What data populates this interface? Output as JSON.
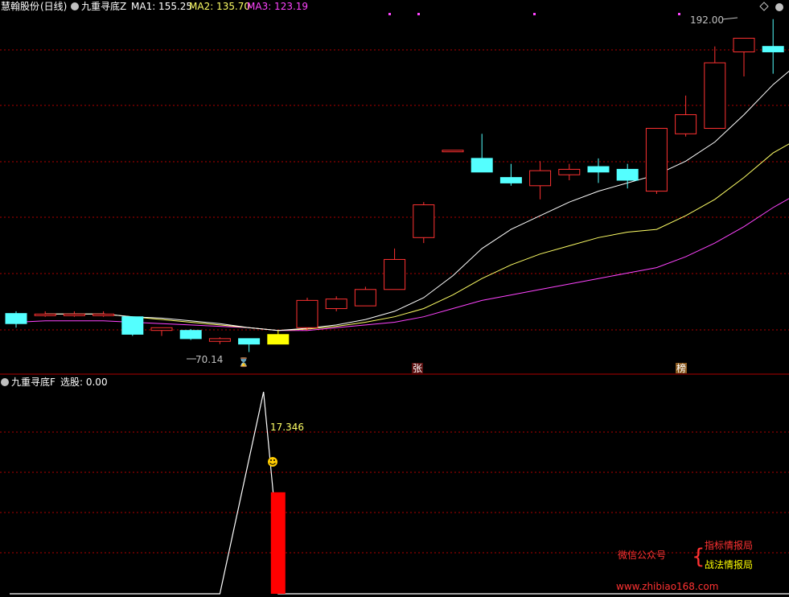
{
  "upper_panel": {
    "stock_name": "慧翰股份",
    "period": "(日线)",
    "indicator_name": "九重寻底Z",
    "ma1_label": "MA1: 155.25",
    "ma2_label": "MA2: 135.70",
    "ma3_label": "MA3: 123.19",
    "high_marker": "192.00",
    "low_marker": "70.14",
    "badge_zhang": "张",
    "badge_bang": "榜"
  },
  "lower_panel": {
    "indicator_name": "九重寻底F",
    "select_label": "选股: 0.00",
    "value_label": "17.346"
  },
  "watermark": {
    "wechat": "微信公众号",
    "line1": "指标情报局",
    "line2": "战法情报局",
    "url": "www.zhibiao168.com"
  },
  "colors": {
    "up": "#ff3232",
    "down": "#54ffff",
    "ma1": "#ffffff",
    "ma2": "#ffff66",
    "ma3": "#ff44ff",
    "grid": "#b00000",
    "signal_bar": "#ff0000",
    "highlight_candle": "#ffff00"
  },
  "chart_data": [
    {
      "type": "candlestick",
      "title": "九重寻底Z",
      "ylim": [
        62,
        199
      ],
      "candles": [
        {
          "o": 84.2,
          "h": 85.0,
          "l": 79.0,
          "c": 80.5
        },
        {
          "o": 84.0,
          "h": 85.0,
          "l": 83.0,
          "c": 84.0
        },
        {
          "o": 84.0,
          "h": 85.0,
          "l": 83.0,
          "c": 84.0
        },
        {
          "o": 84.0,
          "h": 85.0,
          "l": 83.0,
          "c": 84.0
        },
        {
          "o": 83.0,
          "h": 83.0,
          "l": 76.0,
          "c": 76.6
        },
        {
          "o": 78.0,
          "h": 79.0,
          "l": 76.0,
          "c": 79.0
        },
        {
          "o": 78.0,
          "h": 78.5,
          "l": 74.5,
          "c": 75.0
        },
        {
          "o": 74.0,
          "h": 75.5,
          "l": 73.0,
          "c": 75.0
        },
        {
          "o": 75.0,
          "h": 75.0,
          "l": 70.1,
          "c": 73.0
        },
        {
          "o": 73.0,
          "h": 78.0,
          "l": 73.0,
          "c": 76.5
        },
        {
          "o": 79.0,
          "h": 90.0,
          "l": 78.0,
          "c": 89.0
        },
        {
          "o": 86.0,
          "h": 90.5,
          "l": 85.0,
          "c": 89.5
        },
        {
          "o": 87.0,
          "h": 94.0,
          "l": 87.0,
          "c": 93.0
        },
        {
          "o": 93.0,
          "h": 108.0,
          "l": 93.0,
          "c": 104.0
        },
        {
          "o": 112.0,
          "h": 125.0,
          "l": 110.0,
          "c": 124.0
        },
        {
          "o": 144.0,
          "h": 144.0,
          "l": 144.0,
          "c": 144.0
        },
        {
          "o": 141.0,
          "h": 150.0,
          "l": 136.0,
          "c": 136.0
        },
        {
          "o": 134.0,
          "h": 139.0,
          "l": 131.0,
          "c": 132.0
        },
        {
          "o": 131.0,
          "h": 140.0,
          "l": 126.0,
          "c": 136.5
        },
        {
          "o": 135.0,
          "h": 139.0,
          "l": 133.0,
          "c": 137.0
        },
        {
          "o": 138.0,
          "h": 141.0,
          "l": 132.0,
          "c": 136.0
        },
        {
          "o": 137.0,
          "h": 139.0,
          "l": 130.0,
          "c": 133.0
        },
        {
          "o": 129.0,
          "h": 152.0,
          "l": 128.0,
          "c": 152.0
        },
        {
          "o": 150.0,
          "h": 164.0,
          "l": 149.0,
          "c": 157.0
        },
        {
          "o": 152.0,
          "h": 182.0,
          "l": 152.0,
          "c": 176.0
        },
        {
          "o": 180.0,
          "h": 183.0,
          "l": 171.0,
          "c": 185.0
        },
        {
          "o": 182.0,
          "h": 192.0,
          "l": 172.0,
          "c": 180.0
        },
        {
          "o": 172.0,
          "h": 188.0,
          "l": 171.0,
          "c": 188.0
        }
      ],
      "ma1": [
        null,
        84,
        84,
        84,
        83,
        82.5,
        81.5,
        80.5,
        79,
        78,
        78.8,
        80,
        82,
        85,
        90,
        98,
        108,
        115,
        120,
        125,
        129,
        132,
        135,
        140,
        147,
        157,
        168,
        177
      ],
      "ma2": [
        null,
        84,
        84,
        84,
        83,
        82,
        81,
        80,
        79,
        78,
        78.5,
        79.5,
        81,
        83,
        86,
        91,
        97,
        102,
        106,
        109,
        112,
        114,
        115,
        120,
        126,
        134,
        143,
        149
      ],
      "ma3": [
        81,
        81.5,
        81.5,
        81.5,
        81,
        80.5,
        80,
        79.5,
        79,
        78,
        78,
        79,
        80,
        81,
        83,
        86,
        89,
        91,
        93,
        95,
        97,
        99,
        101,
        105,
        110,
        116,
        123,
        129
      ]
    },
    {
      "type": "line",
      "title": "九重寻底F",
      "ylim": [
        0,
        18.5
      ],
      "x": [
        0,
        1,
        2,
        3,
        4,
        5,
        6,
        7,
        8,
        9,
        10,
        11,
        12,
        13,
        14,
        15,
        16,
        17,
        18,
        19,
        20,
        21,
        22,
        23,
        24,
        25,
        26,
        27
      ],
      "values": [
        0,
        0,
        0,
        0,
        0,
        0,
        0,
        0,
        0,
        0,
        0,
        0,
        0,
        0,
        0,
        0,
        0,
        0,
        0,
        0,
        0,
        0,
        0,
        0,
        0,
        0,
        0,
        0
      ],
      "spike_x": [
        7,
        8.5,
        9
      ],
      "spike_values": [
        0,
        18.5,
        4.5
      ],
      "signal_bar": {
        "x": 9,
        "value": 9.3
      },
      "annotation": "17.346"
    }
  ]
}
